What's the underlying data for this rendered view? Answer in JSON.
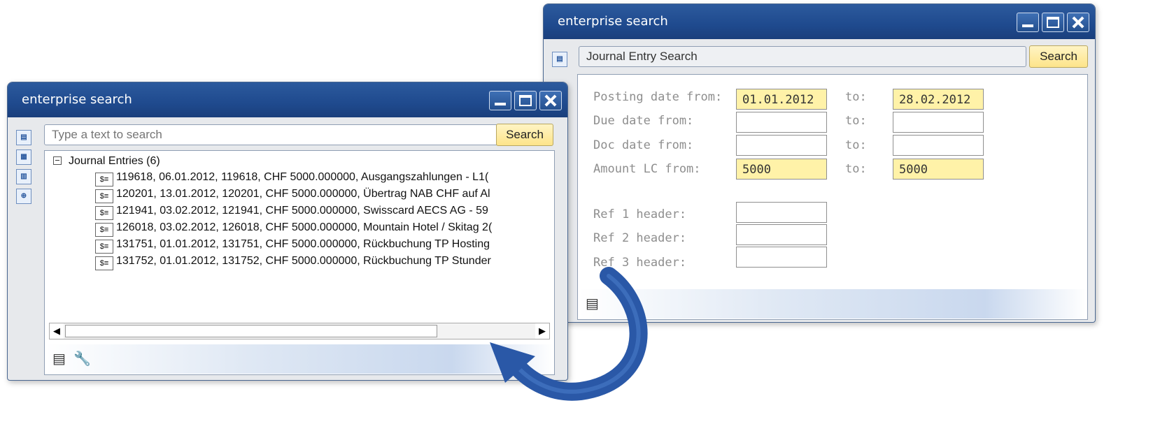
{
  "left_window": {
    "title": "enterprise search",
    "search": {
      "placeholder": "Type a text to search",
      "button": "Search"
    },
    "tree": {
      "header": "Journal Entries (6)",
      "entries": [
        "119618, 06.01.2012, 119618, CHF 5000.000000, Ausgangszahlungen - L1(",
        "120201, 13.01.2012, 120201, CHF 5000.000000, Übertrag NAB CHF auf Al",
        "121941, 03.02.2012, 121941, CHF 5000.000000, Swisscard AECS AG - 59",
        "126018, 03.02.2012, 126018, CHF 5000.000000, Mountain Hotel / Skitag 2(",
        "131751, 01.01.2012, 131751, CHF 5000.000000, Rückbuchung TP Hosting",
        "131752, 01.01.2012, 131752, CHF 5000.000000, Rückbuchung TP Stunder"
      ],
      "entry_icon": "journal-entry-icon"
    },
    "icons": [
      "search-type-icon",
      "business-partner-icon",
      "document-icon",
      "advanced-search-icon"
    ]
  },
  "right_window": {
    "title": "enterprise search",
    "search": {
      "value": "Journal Entry Search",
      "button": "Search"
    },
    "form": {
      "posting_date": {
        "label": "Posting date from:",
        "from": "01.01.2012",
        "to_label": "to:",
        "to": "28.02.2012"
      },
      "due_date": {
        "label": "Due date from:",
        "from": "",
        "to_label": "to:",
        "to": ""
      },
      "doc_date": {
        "label": "Doc date from:",
        "from": "",
        "to_label": "to:",
        "to": ""
      },
      "amount": {
        "label": "Amount LC from:",
        "from": "5000",
        "to_label": "to:",
        "to": "5000"
      },
      "ref1": {
        "label": "Ref 1 header:",
        "value": ""
      },
      "ref2": {
        "label": "Ref 2 header:",
        "value": ""
      },
      "ref3": {
        "label": "Ref 3 header:",
        "value": ""
      }
    }
  },
  "colors": {
    "titlebar": "#1f4a8e",
    "highlight_field": "#fff2a8",
    "arrow": "#2a58a7"
  }
}
